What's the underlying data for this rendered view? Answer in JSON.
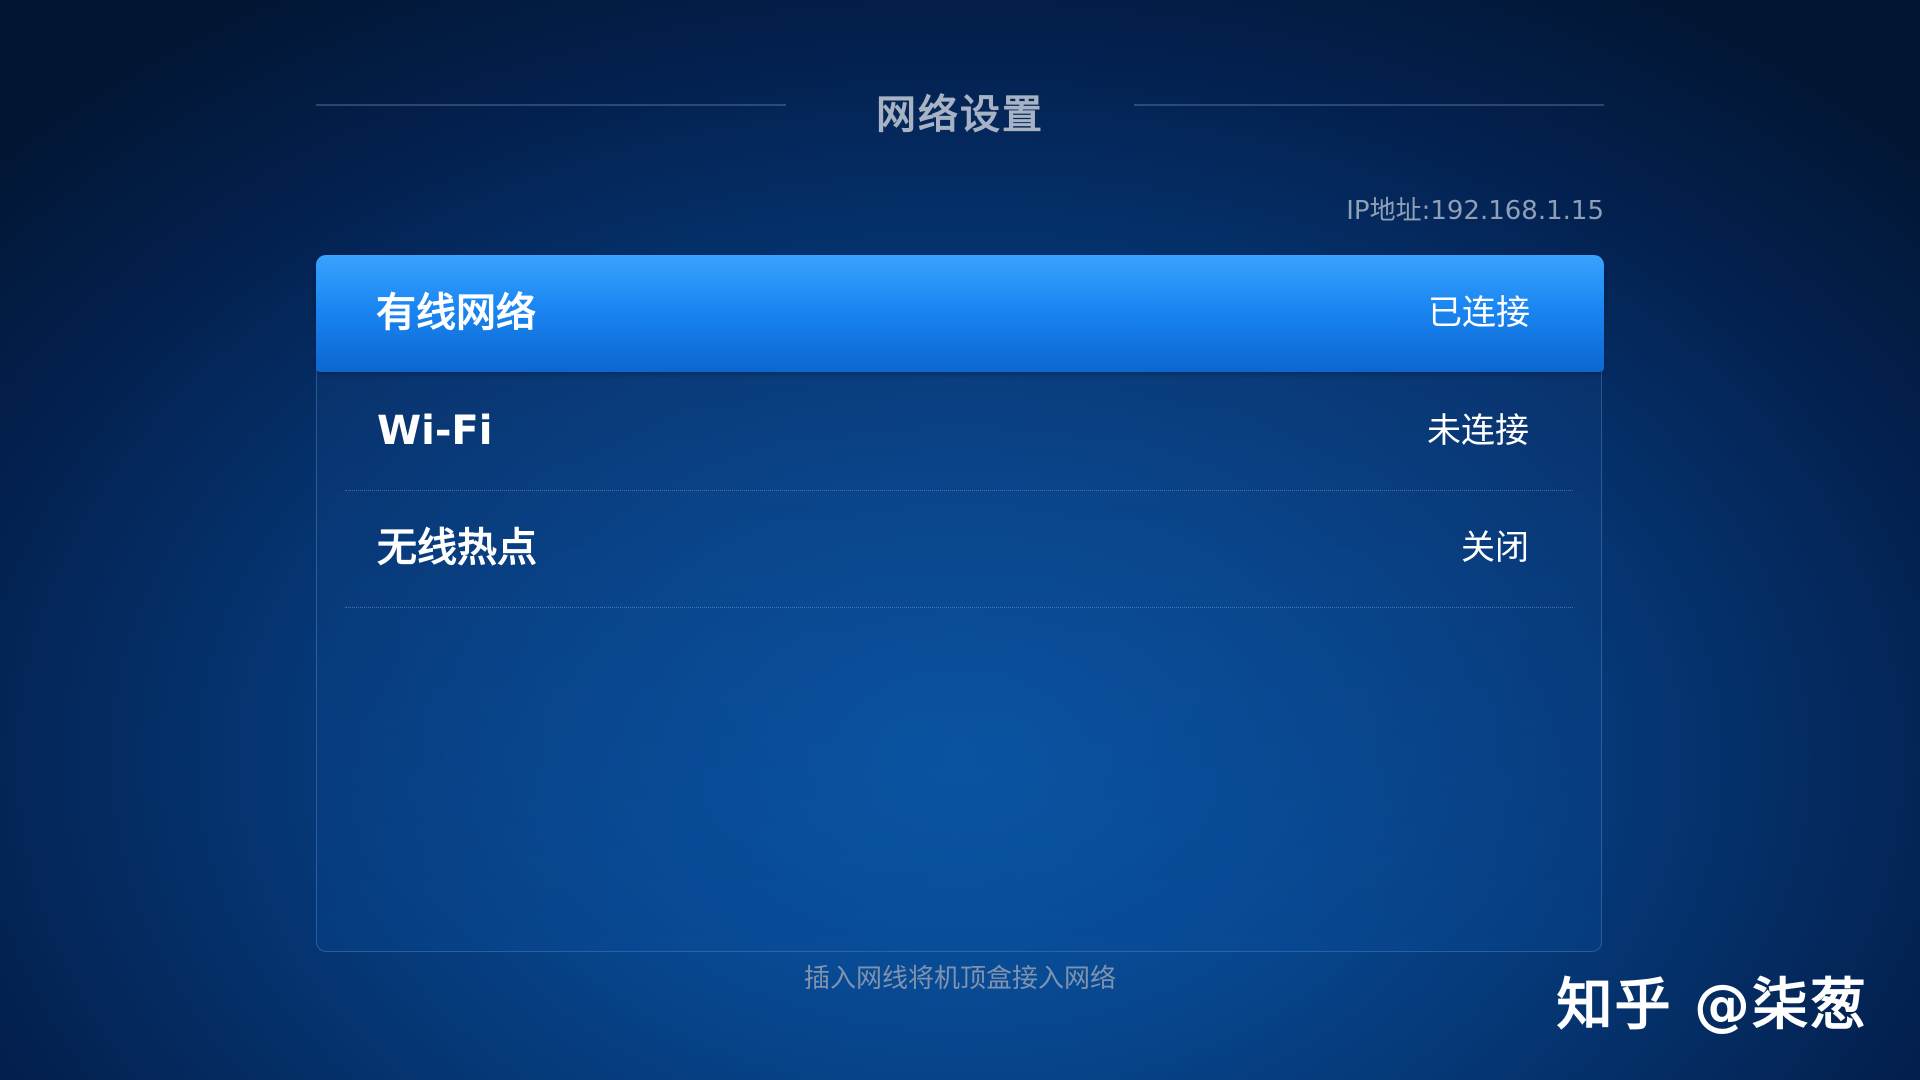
{
  "page": {
    "title": "网络设置",
    "ip_address": "IP地址:192.168.1.15",
    "hint": "插入网线将机顶盒接入网络",
    "watermark": "知乎 @柒葱"
  },
  "menu": {
    "selected_index": 0,
    "items": [
      {
        "label": "有线网络",
        "status": "已连接"
      },
      {
        "label": "Wi-Fi",
        "status": "未连接"
      },
      {
        "label": "无线热点",
        "status": "关闭"
      }
    ]
  },
  "colors": {
    "highlight": "#1a86f2",
    "background": "#07478f",
    "title_text": "#a7b3c4"
  }
}
